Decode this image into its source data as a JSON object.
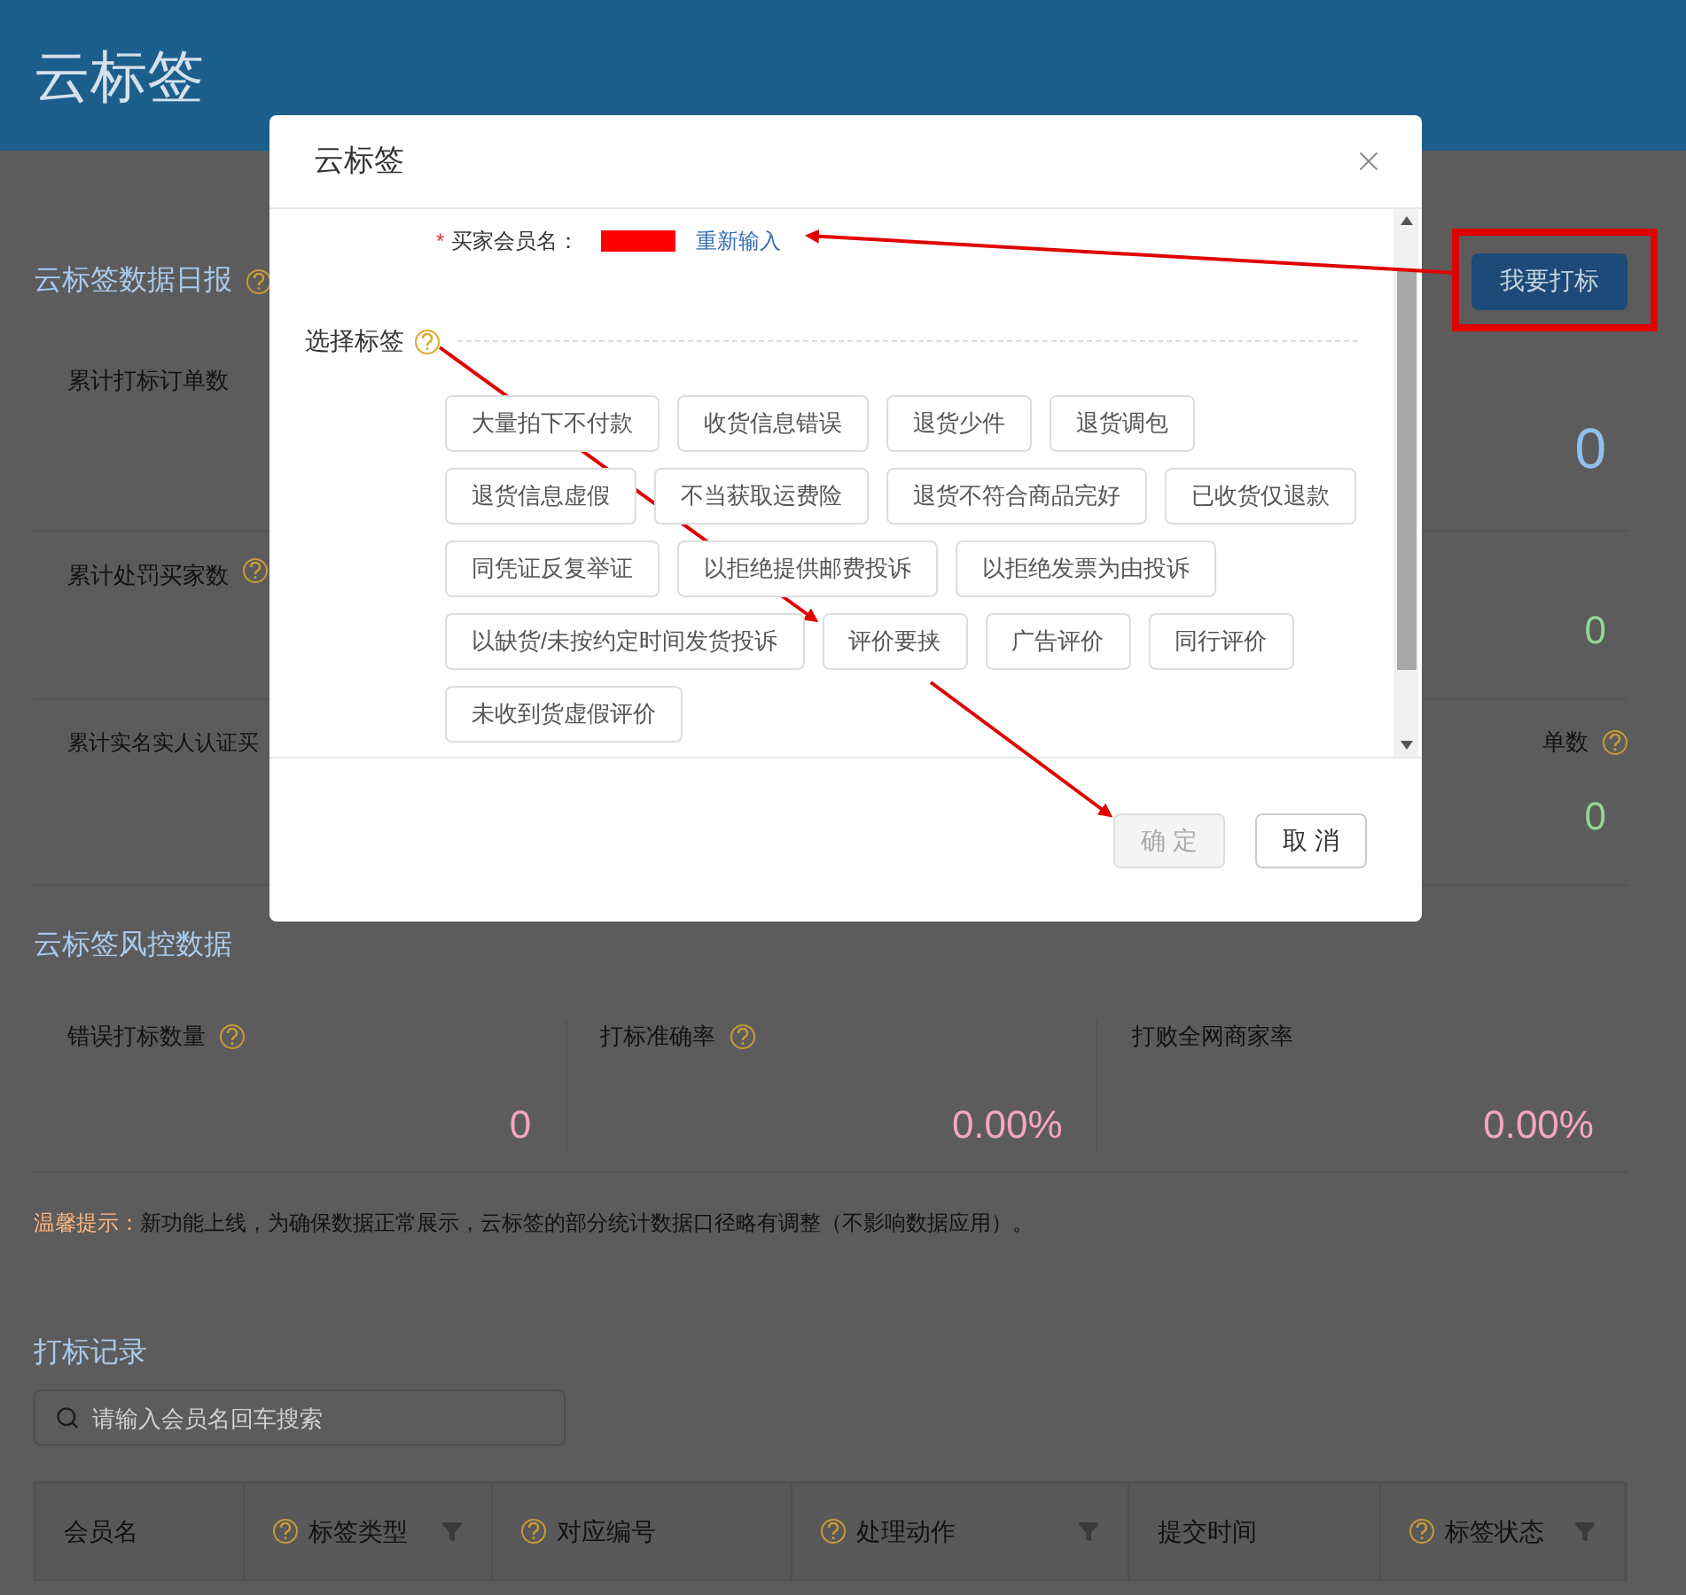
{
  "header": {
    "title": "云标签"
  },
  "daily_report": {
    "title": "云标签数据日报",
    "action_button": "我要打标",
    "rows": [
      {
        "left_label": "累计打标订单数",
        "left_help": false,
        "right_help": false,
        "right_value": "0",
        "color": "#8ec1f0"
      },
      {
        "left_label": "累计处罚买家数",
        "left_help": true,
        "right_help": false,
        "right_value": "0",
        "color": "#8fd88f"
      },
      {
        "left_label": "累计实名实人认证买",
        "left_help": false,
        "right_label": "单数",
        "right_help": true,
        "right_value": "0",
        "color": "#8fd88f"
      }
    ]
  },
  "risk_data": {
    "title": "云标签风控数据",
    "cells": [
      {
        "label": "错误打标数量",
        "help": true,
        "value": "0"
      },
      {
        "label": "打标准确率",
        "help": true,
        "value": "0.00%"
      },
      {
        "label": "打败全网商家率",
        "help": false,
        "value": "0.00%"
      }
    ]
  },
  "tip": {
    "label": "温馨提示：",
    "text": "新功能上线，为确保数据正常展示，云标签的部分统计数据口径略有调整（不影响数据应用）。"
  },
  "records": {
    "title": "打标记录",
    "search": {
      "placeholder": "请输入会员名回车搜索"
    },
    "columns": [
      {
        "label": "会员名",
        "help": false,
        "filter": false
      },
      {
        "label": "标签类型",
        "help": true,
        "filter": true
      },
      {
        "label": "对应编号",
        "help": true,
        "filter": false
      },
      {
        "label": "处理动作",
        "help": true,
        "filter": true
      },
      {
        "label": "提交时间",
        "help": false,
        "filter": false
      },
      {
        "label": "标签状态",
        "help": true,
        "filter": true
      }
    ]
  },
  "dialog": {
    "title": "云标签",
    "buyer_label": "买家会员名：",
    "required_mark": "*",
    "reenter_link": "重新输入",
    "select_label": "选择标签",
    "tags": [
      {
        "label": "大量拍下不付款",
        "selected": false
      },
      {
        "label": "收货信息错误",
        "selected": false
      },
      {
        "label": "退货少件",
        "selected": false
      },
      {
        "label": "退货调包",
        "selected": false
      },
      {
        "label": "退货信息虚假",
        "selected": false
      },
      {
        "label": "不当获取运费险",
        "selected": false
      },
      {
        "label": "退货不符合商品完好",
        "selected": false
      },
      {
        "label": "已收货仅退款",
        "selected": false
      },
      {
        "label": "同凭证反复举证",
        "selected": false
      },
      {
        "label": "以拒绝提供邮费投诉",
        "selected": false
      },
      {
        "label": "以拒绝发票为由投诉",
        "selected": false
      },
      {
        "label": "以缺货/未按约定时间发货投诉",
        "selected": false
      },
      {
        "label": "评价要挟",
        "selected": false
      },
      {
        "label": "广告评价",
        "selected": false
      },
      {
        "label": "同行评价",
        "selected": false
      },
      {
        "label": "未收到货虚假评价",
        "selected": false
      }
    ],
    "buttons": [
      {
        "label": "确 定",
        "kind": "primary",
        "disabled": true
      },
      {
        "label": "取 消",
        "kind": "default",
        "disabled": false
      }
    ]
  }
}
